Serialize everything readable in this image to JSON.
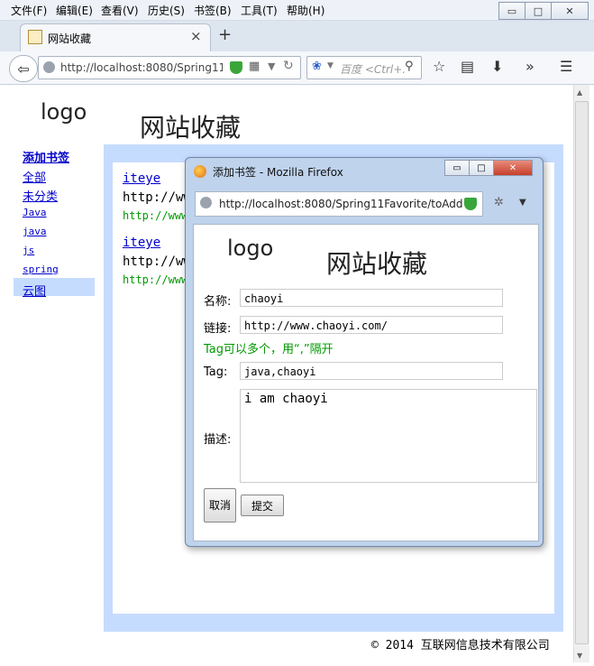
{
  "menubar": {
    "items": [
      "文件(F)",
      "编辑(E)",
      "查看(V)",
      "历史(S)",
      "书签(B)",
      "工具(T)",
      "帮助(H)"
    ]
  },
  "window_controls": {
    "minimize": "▭",
    "maximize": "□",
    "close": "✕"
  },
  "tab": {
    "title": "网站收藏",
    "close": "×",
    "new_tab": "+"
  },
  "toolbar": {
    "url": "http://localhost:8080/Spring11F",
    "search_placeholder": "百度 <Ctrl+.",
    "icons": [
      "back-icon",
      "globe-icon",
      "shield-icon",
      "qr-icon",
      "dropdown-icon",
      "reload-icon",
      "paw-icon",
      "search-icon",
      "star-icon",
      "reader-icon",
      "download-icon",
      "overflow-icon",
      "menu-icon"
    ]
  },
  "page": {
    "logo": "logo",
    "title": "网站收藏",
    "sidebar": [
      {
        "label": "添加书签",
        "bold": true
      },
      {
        "label": "全部"
      },
      {
        "label": "未分类"
      },
      {
        "label": "Java"
      },
      {
        "label": "java"
      },
      {
        "label": "js"
      },
      {
        "label": "spring"
      },
      {
        "label": "云图",
        "active": true
      }
    ],
    "bookmarks": [
      {
        "title": "iteye",
        "url": "http://www.iteye.com",
        "tags": "http://www"
      },
      {
        "title": "iteye",
        "url": "http://www.iteye.com",
        "tags": "http://www"
      }
    ],
    "footer": "© 2014 互联网信息技术有限公司"
  },
  "popup": {
    "window_title": "添加书签 - Mozilla Firefox",
    "url": "http://localhost:8080/Spring11Favorite/toAdd",
    "logo": "logo",
    "title": "网站收藏",
    "form": {
      "name_label": "名称:",
      "name_value": "chaoyi",
      "link_label": "链接:",
      "link_value": "http://www.chaoyi.com/",
      "hint": "Tag可以多个，用“,”隔开",
      "tag_label": "Tag:",
      "tag_value": "java,chaoyi",
      "desc_label": "描述:",
      "desc_value": "i am chaoyi",
      "cancel_label": "取消",
      "submit_label": "提交"
    }
  },
  "colors": {
    "link": "#0000cc",
    "content_frame": "#c6dcff",
    "hint_green": "#009900",
    "popup_frame": "#bfd3ec"
  }
}
